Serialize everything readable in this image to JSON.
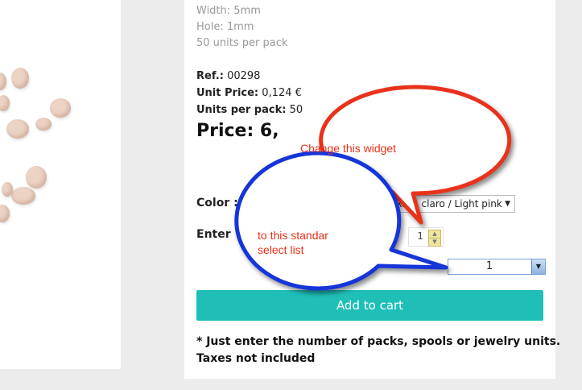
{
  "specs": {
    "width": "Width: 5mm",
    "hole": "Hole: 1mm",
    "units": "50 units per pack"
  },
  "product": {
    "ref_label": "Ref.:",
    "ref_value": "00298",
    "unit_price_label": "Unit Price:",
    "unit_price_value": "0,124 €",
    "units_per_pack_label": "Units per pack:",
    "units_per_pack_value": "50",
    "price_text": "Price: 6,"
  },
  "form": {
    "color_label": "Color :",
    "color_value": "Rosa claro / Light pink",
    "enter_label": "Enter",
    "stepper_value": "1",
    "select_value": "1",
    "add_to_cart": "Add to cart"
  },
  "notes": {
    "line1": "* Just enter the number of packs, spools or jewelry units.",
    "line2": "Taxes not included"
  },
  "annotations": {
    "red_bubble": "Change this widget",
    "blue_bubble_line1": "to this standar",
    "blue_bubble_line2": "select list",
    "red_color": "#e8301a",
    "blue_color": "#1536d8"
  }
}
